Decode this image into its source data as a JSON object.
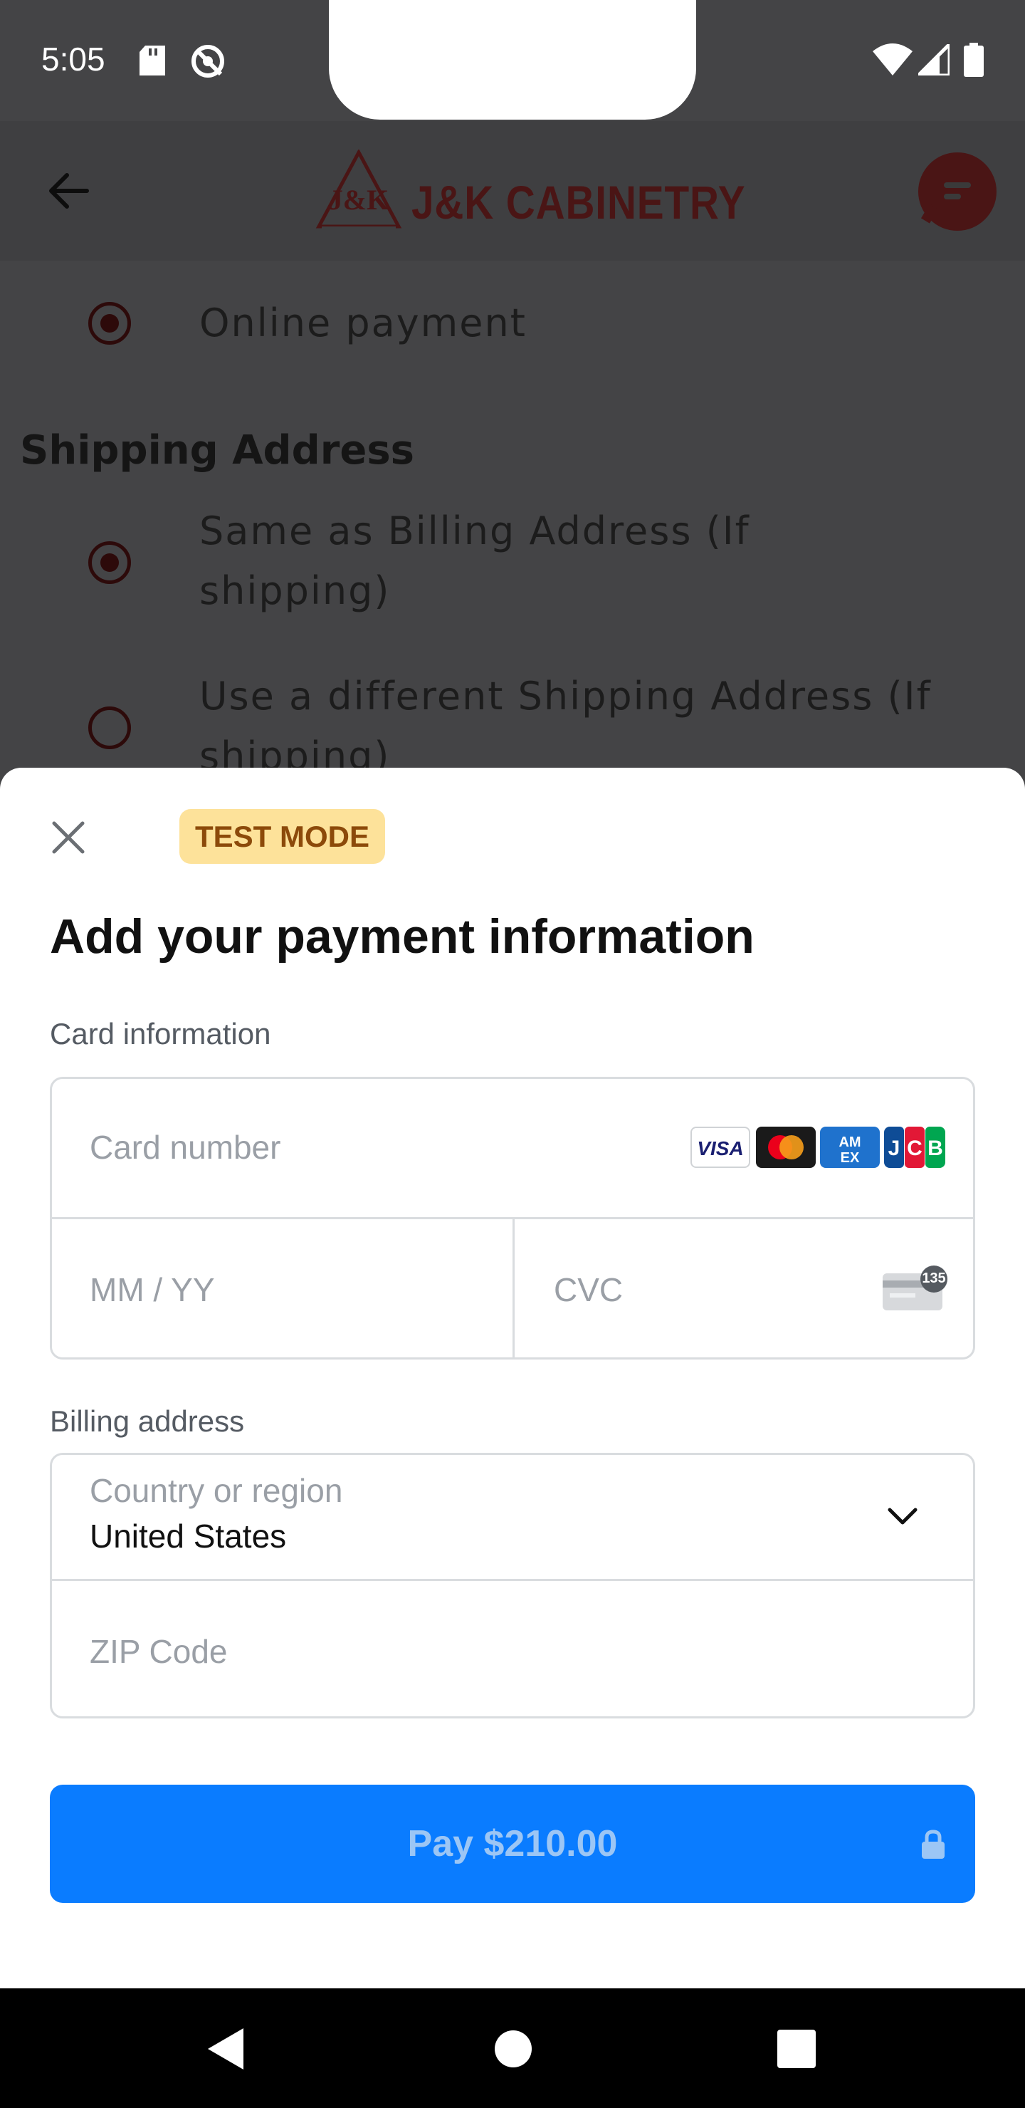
{
  "status_bar": {
    "time": "5:05"
  },
  "header": {
    "brand": "J&K CABINETRY",
    "logo_mark": "J&K CABINETRY"
  },
  "page": {
    "payment_option": "Online payment",
    "shipping_title": "Shipping Address",
    "shipping_options": [
      {
        "label_line1": "Same as Billing Address (If",
        "label_line2": "shipping)",
        "selected": true
      },
      {
        "label_line1": "Use a different Shipping Address (If",
        "label_line2": "shipping)",
        "selected": false
      }
    ]
  },
  "sheet": {
    "badge": "TEST MODE",
    "title": "Add your payment information",
    "card_section_label": "Card information",
    "card_number_placeholder": "Card number",
    "expiry_placeholder": "MM / YY",
    "cvc_placeholder": "CVC",
    "cvc_badge": "135",
    "card_brands": [
      "VISA",
      "Mastercard",
      "AMEX",
      "JCB"
    ],
    "billing_section_label": "Billing address",
    "country_label": "Country or region",
    "country_value": "United States",
    "zip_placeholder": "ZIP Code",
    "pay_button": "Pay $210.00"
  },
  "colors": {
    "accent": "#0a7cff",
    "brand": "#4a1515",
    "badge_bg": "#fde29a"
  }
}
